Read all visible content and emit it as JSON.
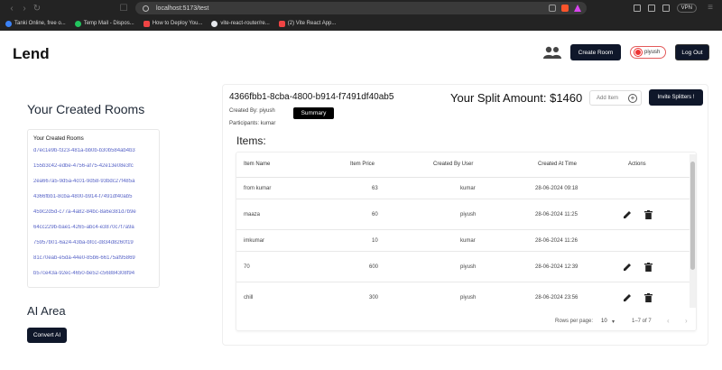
{
  "browser": {
    "url": "localhost:5173/test",
    "bookmarks": [
      {
        "label": "Tanki Online, free o...",
        "color": "#3b82f6"
      },
      {
        "label": "Temp Mail - Dispos...",
        "color": "#22c55e"
      },
      {
        "label": "How to Deploy You...",
        "color": "#ef4444"
      },
      {
        "label": "vite-react-router/re...",
        "color": "#e5e7eb"
      },
      {
        "label": "(2) Vite React App...",
        "color": "#ef4444"
      }
    ],
    "vpn_label": "VPN"
  },
  "header": {
    "title": "Lend",
    "create_room_label": "Create Room",
    "user_name": "piyush",
    "logout_label": "Log Out"
  },
  "sidebar": {
    "heading": "Your Created Rooms",
    "card_title": "Your Created Rooms",
    "rooms": [
      "d7ec1e9b-f323-481a-bb0b-b30b584ab4b3",
      "155b3c42-edbe-4756-af75-42e13e08e3fc",
      "2ea667a5-9d5a-4c01-9d58-93bdc27f485a",
      "4366fbb1-8cba-4800-b914-f7491df40ab5",
      "459c2d5d-c77a-4a82-84bc-8a6e381d7b9e",
      "64cc229b-bae1-4265-abc4-e3870c7f7a9a",
      "75957b01-6a24-43ba-bfcc-d834d8260f19",
      "81c70eab-e5da-44e0-85b6-66175af95869",
      "b57ce43a-92ec-4650-be52-c56884308f94"
    ],
    "ai_heading": "AI Area",
    "convert_ai_label": "Convert AI"
  },
  "room": {
    "id": "4366fbb1-8cba-4800-b914-f7491df40ab5",
    "created_by": "Created By: piyush",
    "participants": "Participants: kumar",
    "summary_label": "Summary",
    "split_amount": "Your Split Amount: $1460",
    "add_item_label": "Add Item",
    "invite_label": "Invite Splitters !"
  },
  "items": {
    "heading": "Items:",
    "columns": [
      "Item Name",
      "Item Price",
      "Created By User",
      "Created At Time",
      "Actions"
    ],
    "rows": [
      {
        "name": "from kumar",
        "price": "63",
        "user": "kumar",
        "time": "28-06-2024 09:18",
        "actions": false
      },
      {
        "name": "maaza",
        "price": "60",
        "user": "piyush",
        "time": "28-06-2024 11:25",
        "actions": true
      },
      {
        "name": "imkumar",
        "price": "10",
        "user": "kumar",
        "time": "28-06-2024 11:26",
        "actions": false
      },
      {
        "name": "70",
        "price": "600",
        "user": "piyush",
        "time": "28-06-2024 12:39",
        "actions": true
      },
      {
        "name": "chill",
        "price": "300",
        "user": "piyush",
        "time": "28-06-2024 23:56",
        "actions": true
      }
    ],
    "rows_per_page_label": "Rows per page:",
    "rows_per_page": "10",
    "range": "1–7 of 7"
  },
  "colors": {
    "accent": "#0f172a",
    "link": "#5b67c8",
    "danger": "#e35b5b"
  }
}
